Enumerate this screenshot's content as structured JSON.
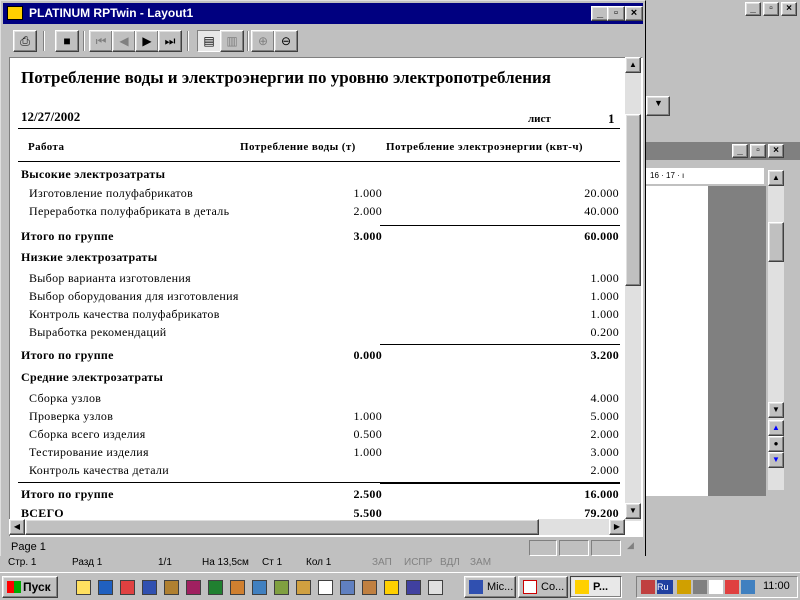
{
  "background_window": {
    "ruler_text": "16 · 17 · ı",
    "controls": [
      "_",
      "▫",
      "×"
    ]
  },
  "window": {
    "title": "PLATINUM RPTwin - Layout1",
    "controls": [
      "_",
      "▫",
      "×"
    ]
  },
  "toolbar": {
    "print": "⎙",
    "stop": "■",
    "first": "⏮",
    "prev": "◀",
    "next": "▶",
    "last": "⏭",
    "single_page": "▤",
    "two_page": "▥",
    "zoom_in": "⊕",
    "zoom_out": "⊖"
  },
  "report": {
    "title": "Потребление воды и электроэнергии по уровню электропотребления",
    "date": "12/27/2002",
    "sheet_label": "лист",
    "sheet_number": "1",
    "col_work": "Работа",
    "col_water": "Потребление воды (т)",
    "col_energy": "Потребление электроэнергии (квт-ч)",
    "rows": [
      {
        "kind": "grp",
        "label": "Высокие электрозатраты",
        "water": "",
        "energy": ""
      },
      {
        "kind": "item",
        "label": "Изготовление полуфабрикатов",
        "water": "1.000",
        "energy": "20.000"
      },
      {
        "kind": "item",
        "label": "Переработка полуфабриката в деталь",
        "water": "2.000",
        "energy": "40.000"
      },
      {
        "kind": "tot",
        "label": "Итого по группе",
        "water": "3.000",
        "energy": "60.000"
      },
      {
        "kind": "grp",
        "label": "Низкие электрозатраты",
        "water": "",
        "energy": ""
      },
      {
        "kind": "item",
        "label": "Выбор  варианта изготовления",
        "water": "",
        "energy": "1.000"
      },
      {
        "kind": "item",
        "label": "Выбор оборудования для изготовления",
        "water": "",
        "energy": "1.000"
      },
      {
        "kind": "item",
        "label": "Контроль качества полуфабрикатов",
        "water": "",
        "energy": "1.000"
      },
      {
        "kind": "item",
        "label": "Выработка рекомендаций",
        "water": "",
        "energy": "0.200"
      },
      {
        "kind": "tot",
        "label": "Итого по группе",
        "water": "0.000",
        "energy": "3.200"
      },
      {
        "kind": "grp",
        "label": "Средние электрозатраты",
        "water": "",
        "energy": ""
      },
      {
        "kind": "item",
        "label": "Сборка узлов",
        "water": "",
        "energy": "4.000"
      },
      {
        "kind": "item",
        "label": "Проверка узлов",
        "water": "1.000",
        "energy": "5.000"
      },
      {
        "kind": "item",
        "label": "Сборка всего изделия",
        "water": "0.500",
        "energy": "2.000"
      },
      {
        "kind": "item",
        "label": "Тестирование изделия",
        "water": "1.000",
        "energy": "3.000"
      },
      {
        "kind": "item",
        "label": "Контроль качества детали",
        "water": "",
        "energy": "2.000"
      },
      {
        "kind": "tot",
        "label": "Итого по группе",
        "water": "2.500",
        "energy": "16.000"
      },
      {
        "kind": "tot",
        "label": "ВСЕГО",
        "water": "5.500",
        "energy": "79.200"
      }
    ]
  },
  "statusbar": {
    "text": "Page 1"
  },
  "word_status": {
    "page": "Стр. 1",
    "section": "Разд  1",
    "pages": "1/1",
    "at": "На  13,5см",
    "line": "Ст  1",
    "col": "Кол  1",
    "rec": "ЗАП",
    "trk": "ИСПР",
    "ext": "ВДЛ",
    "ovr": "ЗАМ"
  },
  "taskbar": {
    "start": "Пуск",
    "tasks": [
      {
        "label": "Mic...",
        "active": false
      },
      {
        "label": "Co...",
        "active": false
      },
      {
        "label": "P...",
        "active": true
      }
    ],
    "lang": "Ru",
    "clock": "11:00"
  },
  "colors": {
    "title_active": "#000080",
    "face": "#c0c0c0"
  }
}
